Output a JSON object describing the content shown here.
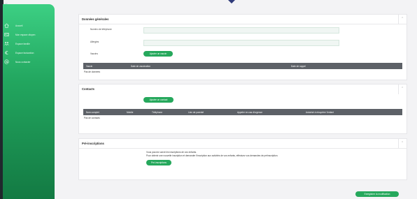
{
  "app": {
    "close_glyph": "×"
  },
  "sidebar": {
    "items": [
      {
        "label": "Accueil",
        "icon": "home-icon"
      },
      {
        "label": "Mon espace citoyen",
        "icon": "id-card-icon"
      },
      {
        "label": "Espace famille",
        "icon": "family-icon"
      },
      {
        "label": "Espace facturation",
        "icon": "euro-icon"
      },
      {
        "label": "Nous contacter",
        "icon": "at-icon"
      }
    ]
  },
  "sections": {
    "general": {
      "title": "Données générales",
      "fields": [
        {
          "label": "Numéro de téléphone"
        },
        {
          "label": "Allergies"
        }
      ],
      "vaccines_label": "Vaccins",
      "add_vaccine_button": "Ajouter un vaccin",
      "table_headers": [
        "Vaccin",
        "Date de vaccination",
        "Date de rappel"
      ],
      "empty_text": "Pas de données"
    },
    "contacts": {
      "title": "Contacts",
      "add_contact_button": "Ajouter un contact",
      "table_headers": [
        "Nom complet",
        "Mobile",
        "Téléphone",
        "Lien de parenté",
        "Appeler en cas d'urgence",
        "Autorisé à récupérer l'enfant"
      ],
      "empty_text": "Pas de contacts"
    },
    "preinscriptions": {
      "title": "Pré-inscriptions",
      "note_line1": "Vous pouvez suivre les inscriptions de vos enfants.",
      "note_line2": "Pour obtenir une nouvelle inscription et demander l'inscription aux activités de vos enfants, effectuez vos demandes de préinscription.",
      "button": "Pré-inscriptions"
    }
  },
  "footer": {
    "save_button": "Enregistrer la modification"
  },
  "colors": {
    "accent": "#26a85c",
    "sidebar_top": "#3ccf83",
    "sidebar_bottom": "#137a43",
    "table_header": "#5d6167"
  }
}
